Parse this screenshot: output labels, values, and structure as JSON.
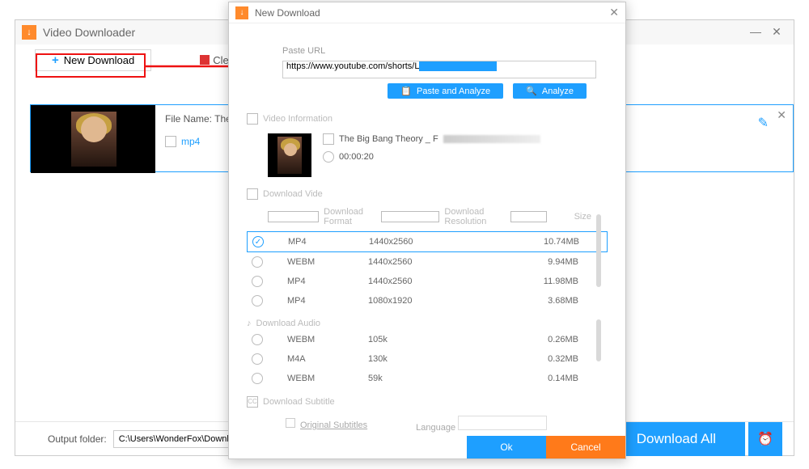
{
  "main": {
    "title": "Video Downloader",
    "new_download": "New Download",
    "clear": "Clea",
    "file_name_prefix": "File Name: The Big",
    "format_tag": "mp4",
    "output_label": "Output folder:",
    "output_path": "C:\\Users\\WonderFox\\Downloads",
    "download_all": "Download All"
  },
  "dialog": {
    "title": "New Download",
    "paste_url_label": "Paste URL",
    "url_plain": "https://www.youtube.com/shorts/L",
    "paste_analyze": "Paste and Analyze",
    "analyze": "Analyze",
    "video_info_label": "Video Information",
    "video_title": "The Big Bang Theory _ F",
    "video_duration": "00:00:20",
    "download_video_label": "Download Vide",
    "col_format": "Download Format",
    "col_res": "Download Resolution",
    "col_size": "Size",
    "video_rows": [
      {
        "fmt": "MP4",
        "res": "1440x2560",
        "size": "10.74MB",
        "selected": true
      },
      {
        "fmt": "WEBM",
        "res": "1440x2560",
        "size": "9.94MB",
        "selected": false
      },
      {
        "fmt": "MP4",
        "res": "1440x2560",
        "size": "11.98MB",
        "selected": false
      },
      {
        "fmt": "MP4",
        "res": "1080x1920",
        "size": "3.68MB",
        "selected": false
      }
    ],
    "download_audio_label": "Download Audio",
    "audio_rows": [
      {
        "fmt": "WEBM",
        "res": "105k",
        "size": "0.26MB"
      },
      {
        "fmt": "M4A",
        "res": "130k",
        "size": "0.32MB"
      },
      {
        "fmt": "WEBM",
        "res": "59k",
        "size": "0.14MB"
      }
    ],
    "download_subtitle_label": "Download Subtitle",
    "orig_sub": "Original Subtitles",
    "language": "Language",
    "ok": "Ok",
    "cancel": "Cancel"
  }
}
